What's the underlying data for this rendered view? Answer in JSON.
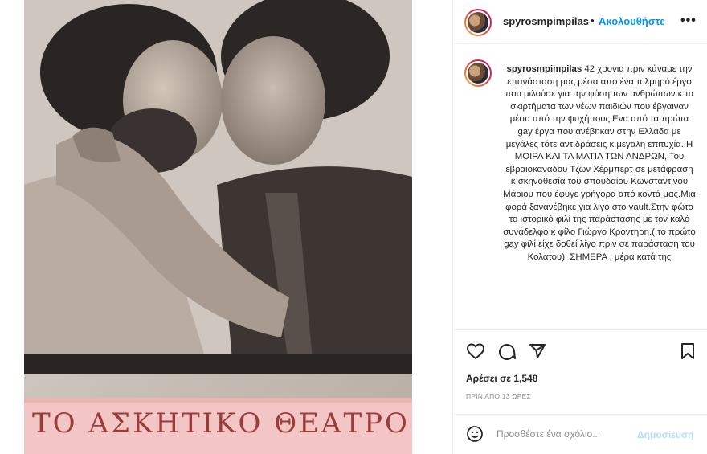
{
  "post": {
    "username": "spyrosmpimpilas",
    "separator": "•",
    "follow_label": "Ακολουθήστε",
    "more_label": "•••",
    "caption": "42 χρονια πριν κάναμε την επανάσταση μας μέσα από ένα τολμηρό έργο που μιλούσε για την φύση των ανθρώπων κ τα σκιρτήματα των νέων παιδιών που έβγαιναν μέσα από την ψυχή τους.Ενα από τα πρώτα gay έργα που ανέβηκαν στην Ελλαδα με μεγάλες τότε αντιδράσεις κ.μεγαλη επιτυχία..Η ΜΟΙΡΑ ΚΑΙ ΤΑ ΜΑΤΙΑ ΤΩΝ ΑΝΔΡΩΝ, Του εβραιοκαναδου Τζων Χέρμπερτ σε μετάφραση κ σκηνοθεσία του σπουδαίου Κωνσταντινου Μάριου που έφυγε γρήγορα από κοντά μας.Μια φορά ξανανέβηκε για λίγο στο vault.Στην φώτο το ιστορικό φιλί της παράστασης με τον καλό συνάδελφο κ φίλο Γιώργο Κροντηρη.( το πρώτο gay φιλί είχε δοθεί λίγο πριν σε παράσταση του Κολατου). ΣΗΜΕΡΑ , μέρα κατά της",
    "likes": "Αρέσει σε 1,548",
    "time": "ΠΡΙΝ ΑΠΟ 13 ΩΡΕΣ"
  },
  "photo": {
    "banner_text": "ΤΟ ΑΣΚΗΤΙΚΟ ΘΕΑΤΡΟ"
  },
  "comment": {
    "placeholder": "Προσθέστε ένα σχόλιο...",
    "post_label": "Δημοσίευση"
  },
  "icons": {
    "like": "heart-icon",
    "comment": "comment-icon",
    "share": "share-icon",
    "save": "bookmark-icon",
    "emoji": "emoji-icon"
  },
  "colors": {
    "link": "#0095f6",
    "post_disabled": "#b2dffc",
    "muted": "#8e8e8e",
    "banner": "#f2c6c4",
    "banner_text": "#9e3a3a"
  }
}
